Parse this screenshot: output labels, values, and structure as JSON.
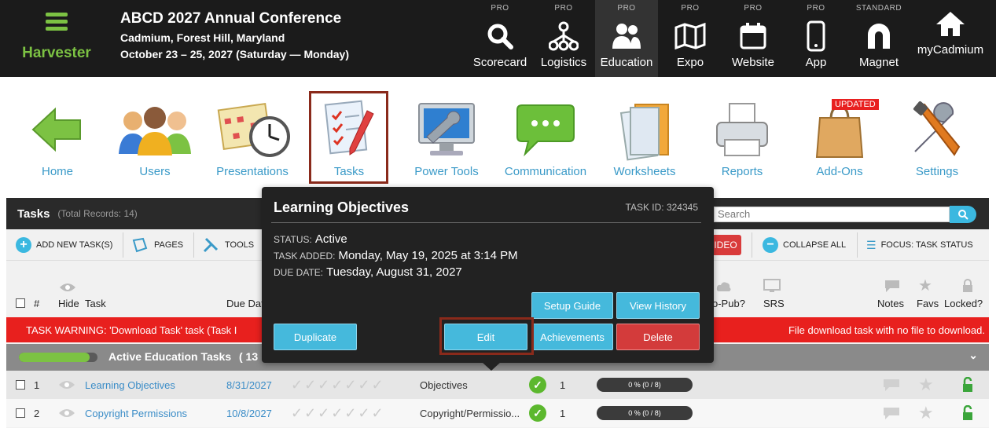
{
  "brand": {
    "name": "Harvester"
  },
  "conference": {
    "title": "ABCD 2027 Annual Conference",
    "location": "Cadmium, Forest Hill, Maryland",
    "dates": "October 23 – 25, 2027 (Saturday — Monday)"
  },
  "modules": [
    {
      "tier": "PRO",
      "label": "Scorecard",
      "icon": "search-icon"
    },
    {
      "tier": "PRO",
      "label": "Logistics",
      "icon": "network-icon"
    },
    {
      "tier": "PRO",
      "label": "Education",
      "icon": "people-icon"
    },
    {
      "tier": "PRO",
      "label": "Expo",
      "icon": "map-icon"
    },
    {
      "tier": "PRO",
      "label": "Website",
      "icon": "browser-icon"
    },
    {
      "tier": "PRO",
      "label": "App",
      "icon": "phone-icon"
    },
    {
      "tier": "STANDARD",
      "label": "Magnet",
      "icon": "magnet-icon"
    },
    {
      "tier": "",
      "label": "myCadmium",
      "icon": "home-icon"
    }
  ],
  "tiles": [
    {
      "label": "Home"
    },
    {
      "label": "Users"
    },
    {
      "label": "Presentations"
    },
    {
      "label": "Tasks"
    },
    {
      "label": "Power Tools"
    },
    {
      "label": "Communication"
    },
    {
      "label": "Worksheets"
    },
    {
      "label": "Reports"
    },
    {
      "label": "Add-Ons",
      "badge": "UPDATED"
    },
    {
      "label": "Settings"
    }
  ],
  "panel": {
    "title": "Tasks",
    "count": "(Total Records: 14)",
    "search_placeholder": "Search"
  },
  "toolbar": {
    "add": "ADD NEW TASK(S)",
    "pages": "PAGES",
    "tools": "TOOLS",
    "video": "IDEO",
    "collapse": "COLLAPSE ALL",
    "focus": "FOCUS: TASK STATUS"
  },
  "columns": {
    "num": "#",
    "hide": "Hide",
    "task": "Task",
    "due": "Due Dat",
    "autopub": "o-Pub?",
    "srs": "SRS",
    "notes": "Notes",
    "favs": "Favs",
    "locked": "Locked?"
  },
  "warning": {
    "left": "TASK WARNING: 'Download Task' task (Task I",
    "right": "File download task with no file to download."
  },
  "group": {
    "label": "Active Education Tasks",
    "count": "( 13",
    "progress": 0.9
  },
  "rows": [
    {
      "num": "1",
      "task": "Learning Objectives",
      "due": "8/31/2027",
      "type": "Objectives",
      "count": "1",
      "progress": "0 % (0 / 8)"
    },
    {
      "num": "2",
      "task": "Copyright Permissions",
      "due": "10/8/2027",
      "type": "Copyright/Permissio...",
      "count": "1",
      "progress": "0 % (0 / 8)"
    }
  ],
  "popup": {
    "title": "Learning Objectives",
    "task_id": "TASK ID: 324345",
    "status_label": "STATUS:",
    "status": "Active",
    "added_label": "TASK ADDED:",
    "added": "Monday, May 19, 2025 at 3:14 PM",
    "due_label": "DUE DATE:",
    "due": "Tuesday, August 31, 2027",
    "buttons": {
      "setup": "Setup Guide",
      "history": "View History",
      "duplicate": "Duplicate",
      "edit": "Edit",
      "achievements": "Achievements",
      "delete": "Delete"
    }
  },
  "colors": {
    "accent": "#45b9dc",
    "brand_green": "#7cc243",
    "danger": "#d33b3b",
    "highlight_frame": "#8a2a1b"
  }
}
